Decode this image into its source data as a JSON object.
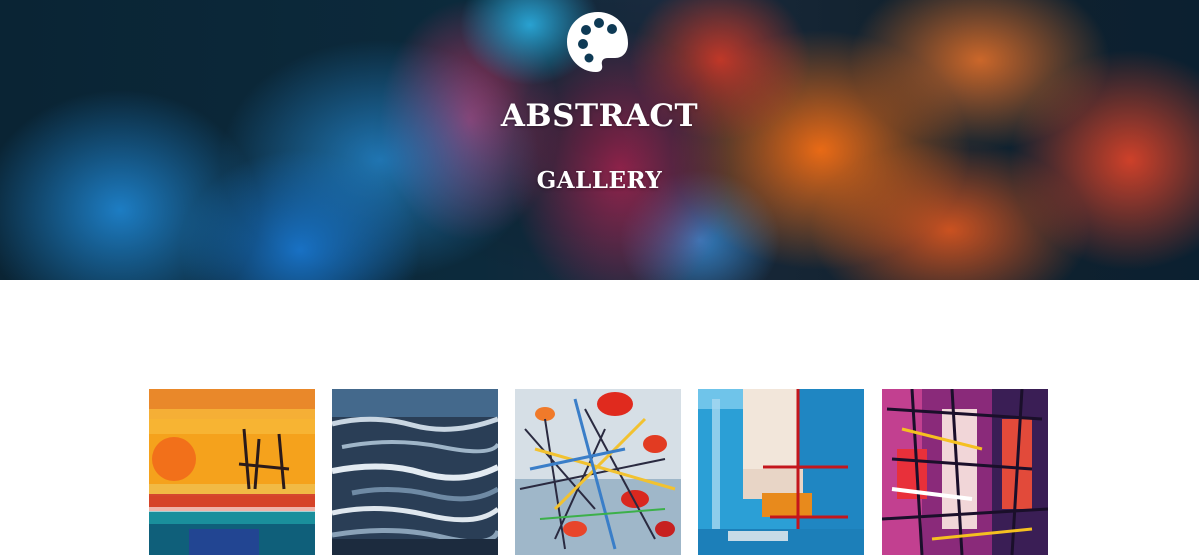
{
  "hero": {
    "icon": "palette-icon",
    "title": "ABSTRACT",
    "subtitle": "GALLERY"
  },
  "gallery": {
    "items": [
      {
        "name": "painting-sunset-sea",
        "dominant_color": "#f39a1a"
      },
      {
        "name": "painting-dark-waves",
        "dominant_color": "#2f4a66"
      },
      {
        "name": "painting-colorful-splatter",
        "dominant_color": "#c9d6e0"
      },
      {
        "name": "painting-blue-geometric",
        "dominant_color": "#2aa0d4"
      },
      {
        "name": "painting-magenta-abstract",
        "dominant_color": "#9a2a7a"
      }
    ]
  }
}
